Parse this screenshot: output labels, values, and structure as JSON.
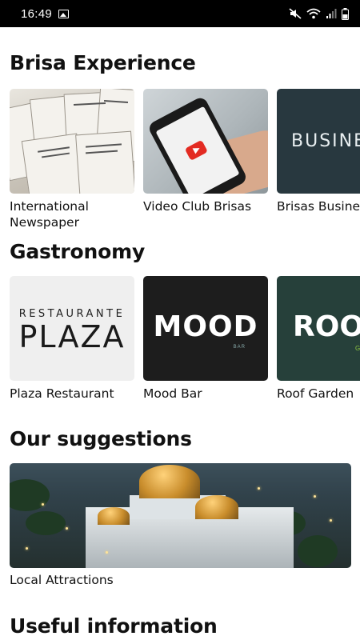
{
  "status_bar": {
    "time": "16:49"
  },
  "sections": {
    "experience": {
      "title": "Brisa Experience",
      "cards": [
        {
          "label": "International Newspaper"
        },
        {
          "label": "Video Club Brisas"
        },
        {
          "label": "Brisas Business",
          "thumb_text": "BUSINE"
        }
      ]
    },
    "gastronomy": {
      "title": "Gastronomy",
      "cards": [
        {
          "label": "Plaza Restaurant",
          "logo_small": "RESTAURANTE",
          "logo_big": "PLAZA"
        },
        {
          "label": "Mood Bar",
          "logo_text": "MOOD",
          "logo_sub": "BAR"
        },
        {
          "label": "Roof Garden",
          "logo_text": "ROO",
          "logo_sub": "G"
        }
      ]
    },
    "suggestions": {
      "title": "Our suggestions",
      "cards": [
        {
          "label": "Local Attractions"
        }
      ]
    },
    "useful": {
      "title": "Useful information"
    }
  },
  "colors": {
    "status_bar_bg": "#000000",
    "page_bg": "#ffffff",
    "mood_ring": "#2a7fc1",
    "roof_green": "#8cc43f"
  }
}
